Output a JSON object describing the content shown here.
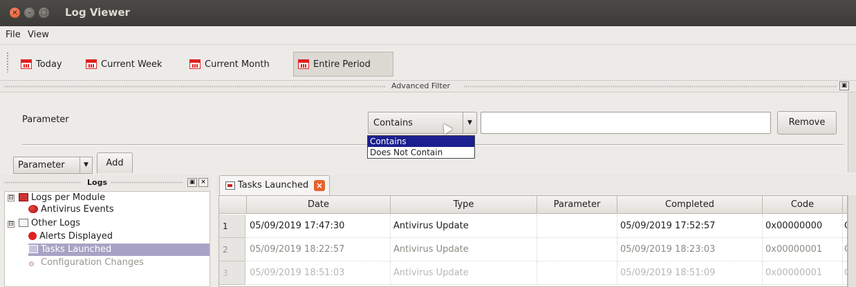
{
  "window": {
    "title": "Log Viewer",
    "close_glyph": "×",
    "min_glyph": "–",
    "max_glyph": "□"
  },
  "menu": {
    "file": "File",
    "view": "View"
  },
  "toolbar": {
    "buttons": [
      {
        "label": "Today",
        "icon": "calendar-icon"
      },
      {
        "label": "Current Week",
        "icon": "calendar-icon"
      },
      {
        "label": "Current Month",
        "icon": "calendar-icon"
      },
      {
        "label": "Entire Period",
        "icon": "calendar-icon",
        "active": true
      }
    ]
  },
  "advanced_filter": {
    "title": "Advanced Filter",
    "parameter_label": "Parameter",
    "operator_selected": "Contains",
    "operator_options": [
      "Contains",
      "Does Not Contain"
    ],
    "value": "",
    "remove_label": "Remove",
    "add_combo_value": "Parameter",
    "add_label": "Add"
  },
  "logs_panel": {
    "title": "Logs",
    "tree": [
      {
        "label": "Logs per Module",
        "icon": "module-icon",
        "expander": "⊟"
      },
      {
        "label": "Antivirus Events",
        "icon": "antivirus-icon"
      },
      {
        "label": "Other Logs",
        "icon": "folder-icon",
        "expander": "⊟"
      },
      {
        "label": "Alerts Displayed",
        "icon": "alert-icon"
      },
      {
        "label": "Tasks Launched",
        "icon": "tasks-icon",
        "selected": true
      },
      {
        "label": "Configuration Changes",
        "icon": "config-icon"
      }
    ]
  },
  "tab": {
    "label": "Tasks Launched",
    "close_glyph": "×"
  },
  "table": {
    "columns": [
      "Date",
      "Type",
      "Parameter",
      "Completed",
      "Code"
    ],
    "rows": [
      {
        "num": "1",
        "date": "05/09/2019 17:47:30",
        "type": "Antivirus Update",
        "parameter": "",
        "completed": "05/09/2019 17:52:57",
        "code": "0x00000000",
        "extra": "C"
      },
      {
        "num": "2",
        "date": "05/09/2019 18:22:57",
        "type": "Antivirus Update",
        "parameter": "",
        "completed": "05/09/2019 18:23:03",
        "code": "0x00000001",
        "extra": "C"
      },
      {
        "num": "3",
        "date": "05/09/2019 18:51:03",
        "type": "Antivirus Update",
        "parameter": "",
        "completed": "05/09/2019 18:51:09",
        "code": "0x00000001",
        "extra": "C"
      }
    ]
  }
}
